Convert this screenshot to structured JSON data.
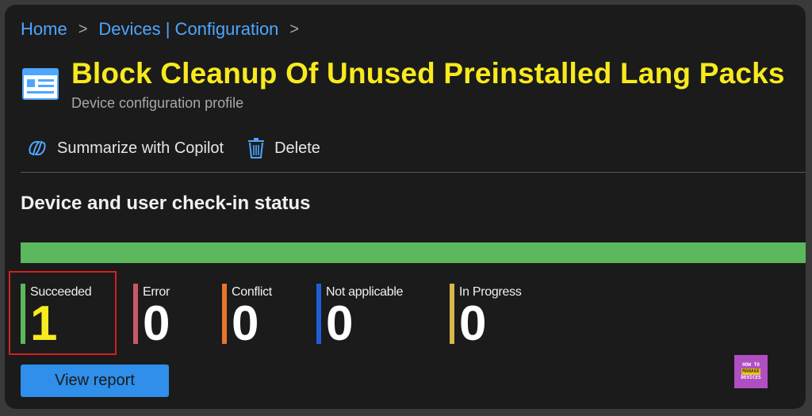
{
  "breadcrumb": {
    "items": [
      "Home",
      "Devices | Configuration"
    ],
    "separator": ">"
  },
  "header": {
    "title": "Block Cleanup Of Unused Preinstalled Lang Packs",
    "subtitle": "Device configuration profile"
  },
  "toolbar": {
    "copilot_label": "Summarize with Copilot",
    "delete_label": "Delete"
  },
  "status": {
    "section_title": "Device and user check-in status",
    "progress": {
      "succeeded_fraction": 1.0,
      "color": "#5cb85c"
    },
    "stats": [
      {
        "label": "Succeeded",
        "value": "1",
        "color": "#5cb85c"
      },
      {
        "label": "Error",
        "value": "0",
        "color": "#c8596a"
      },
      {
        "label": "Conflict",
        "value": "0",
        "color": "#e8742e"
      },
      {
        "label": "Not applicable",
        "value": "0",
        "color": "#1f5fd6"
      },
      {
        "label": "In Progress",
        "value": "0",
        "color": "#d8b74b"
      }
    ]
  },
  "actions": {
    "view_report_label": "View report"
  },
  "logo": {
    "line1": "HOW TO",
    "line2": "MANAGE",
    "line3": "DEVICES"
  },
  "colors": {
    "accent_link": "#4fa6ff",
    "title_highlight": "#f7ea1e",
    "button": "#2f8fea",
    "annotation_box": "#d22020"
  }
}
